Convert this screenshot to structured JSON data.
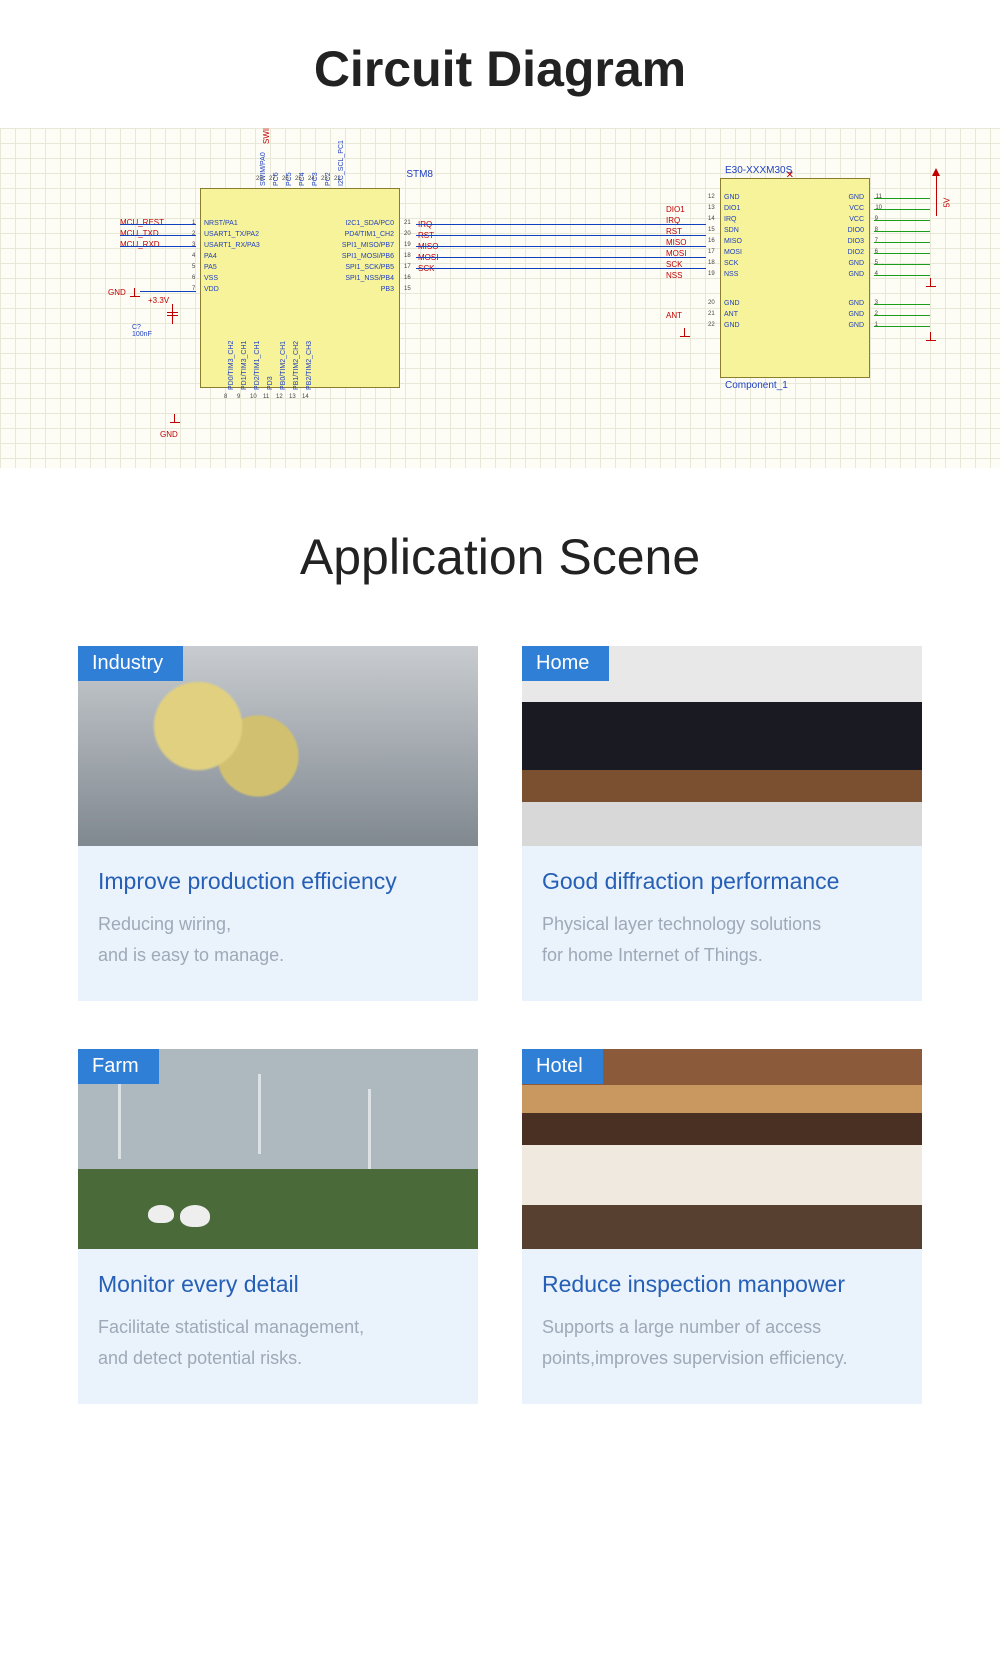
{
  "section1_title": "Circuit Diagram",
  "section2_title": "Application Scene",
  "diagram": {
    "chip1_label": "STM8",
    "chip2_label": "E30-XXXM30S",
    "chip2_bottom": "Component_1",
    "power_labels": {
      "v33": "+3.3V",
      "v5": "5V",
      "gnd": "GND",
      "cap": "C?\n100nF"
    },
    "mcu_left_nets": [
      "MCU_REST",
      "MCU_TXD",
      "MCU_RXD"
    ],
    "swim_label": "SWIM",
    "chip1_left_pins": [
      {
        "n": "1",
        "name": "NRST/PA1"
      },
      {
        "n": "2",
        "name": "USART1_TX/PA2"
      },
      {
        "n": "3",
        "name": "USART1_RX/PA3"
      },
      {
        "n": "4",
        "name": "PA4"
      },
      {
        "n": "5",
        "name": "PA5"
      },
      {
        "n": "6",
        "name": "VSS"
      },
      {
        "n": "7",
        "name": "VDD"
      }
    ],
    "chip1_top_pins": [
      {
        "n": "28",
        "name": "SWIM/PA0"
      },
      {
        "n": "27",
        "name": "PC6"
      },
      {
        "n": "26",
        "name": "PC5"
      },
      {
        "n": "25",
        "name": "PC4"
      },
      {
        "n": "24",
        "name": "PC3"
      },
      {
        "n": "23",
        "name": "PC2"
      },
      {
        "n": "22",
        "name": "I2C_SCL_PC1"
      }
    ],
    "chip1_right_pins": [
      {
        "n": "21",
        "name": "I2C1_SDA/PC0",
        "net": "IRQ"
      },
      {
        "n": "20",
        "name": "PD4/TIM1_CH2",
        "net": "RST"
      },
      {
        "n": "19",
        "name": "SPI1_MISO/PB7",
        "net": "MISO"
      },
      {
        "n": "18",
        "name": "SPI1_MOSI/PB6",
        "net": "MOSI"
      },
      {
        "n": "17",
        "name": "SPI1_SCK/PB5",
        "net": "SCK"
      },
      {
        "n": "16",
        "name": "SPI1_NSS/PB4",
        "net": ""
      },
      {
        "n": "15",
        "name": "PB3",
        "net": ""
      }
    ],
    "chip1_bottom_pins": [
      {
        "n": "8",
        "name": "PD0/TIM3_CH2"
      },
      {
        "n": "9",
        "name": "PD1/TIM3_CH1"
      },
      {
        "n": "10",
        "name": "PD2/TIM1_CH1"
      },
      {
        "n": "11",
        "name": "PD3"
      },
      {
        "n": "12",
        "name": "PB0/TIM2_CH1"
      },
      {
        "n": "13",
        "name": "PB1/TIM2_CH2"
      },
      {
        "n": "14",
        "name": "PB2/TIM2_CH3"
      }
    ],
    "chip2_left_pins": [
      {
        "n": "12",
        "name": "GND"
      },
      {
        "n": "13",
        "name": "DIO1",
        "net": "DIO1"
      },
      {
        "n": "14",
        "name": "IRQ",
        "net": "IRQ"
      },
      {
        "n": "15",
        "name": "SDN",
        "net": "RST"
      },
      {
        "n": "16",
        "name": "MISO",
        "net": "MISO"
      },
      {
        "n": "17",
        "name": "MOSI",
        "net": "MOSI"
      },
      {
        "n": "18",
        "name": "SCK",
        "net": "SCK"
      },
      {
        "n": "19",
        "name": "NSS",
        "net": "NSS"
      }
    ],
    "chip2_left_pins_b": [
      {
        "n": "20",
        "name": "GND",
        "net": "ANT"
      },
      {
        "n": "21",
        "name": "ANT"
      },
      {
        "n": "22",
        "name": "GND"
      }
    ],
    "chip2_right_pins": [
      {
        "n": "11",
        "name": "GND"
      },
      {
        "n": "10",
        "name": "VCC"
      },
      {
        "n": "9",
        "name": "VCC"
      },
      {
        "n": "8",
        "name": "DIO0"
      },
      {
        "n": "7",
        "name": "DIO3"
      },
      {
        "n": "6",
        "name": "DIO2"
      },
      {
        "n": "5",
        "name": "GND"
      },
      {
        "n": "4",
        "name": "GND"
      }
    ],
    "chip2_right_pins_b": [
      {
        "n": "3",
        "name": "GND"
      },
      {
        "n": "2",
        "name": "GND"
      },
      {
        "n": "1",
        "name": "GND"
      }
    ]
  },
  "cards": [
    {
      "tag": "Industry",
      "heading": "Improve production efficiency",
      "line1": "Reducing wiring,",
      "line2": "and is easy to manage.",
      "img": "img-industry"
    },
    {
      "tag": "Home",
      "heading": "Good diffraction performance",
      "line1": "Physical layer technology solutions",
      "line2": "for home Internet of Things.",
      "img": "img-home"
    },
    {
      "tag": "Farm",
      "heading": "Monitor every detail",
      "line1": "Facilitate statistical management,",
      "line2": "and detect potential risks.",
      "img": "img-farm"
    },
    {
      "tag": "Hotel",
      "heading": "Reduce inspection manpower",
      "line1": "Supports a large number of access",
      "line2": "points,improves supervision efficiency.",
      "img": "img-hotel"
    }
  ]
}
